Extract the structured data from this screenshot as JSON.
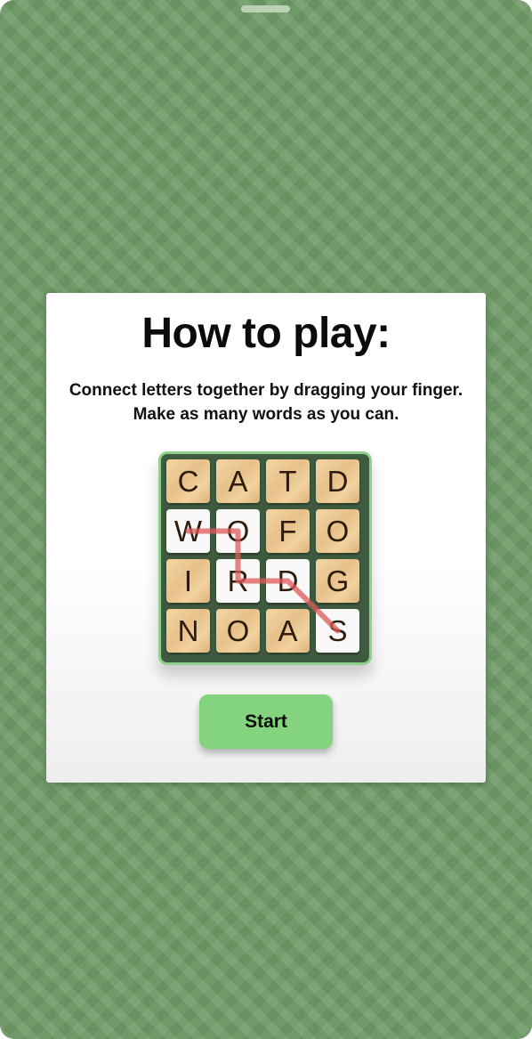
{
  "dialog": {
    "title": "How to play:",
    "instructions": "Connect letters together by dragging your finger. Make as many words as you can.",
    "start_label": "Start"
  },
  "board": {
    "tiles": [
      {
        "letter": "C",
        "selected": false
      },
      {
        "letter": "A",
        "selected": false
      },
      {
        "letter": "T",
        "selected": false
      },
      {
        "letter": "D",
        "selected": false
      },
      {
        "letter": "W",
        "selected": true
      },
      {
        "letter": "O",
        "selected": true
      },
      {
        "letter": "F",
        "selected": false
      },
      {
        "letter": "O",
        "selected": false
      },
      {
        "letter": "I",
        "selected": false
      },
      {
        "letter": "R",
        "selected": true
      },
      {
        "letter": "D",
        "selected": true
      },
      {
        "letter": "G",
        "selected": false
      },
      {
        "letter": "N",
        "selected": false
      },
      {
        "letter": "O",
        "selected": false
      },
      {
        "letter": "A",
        "selected": false
      },
      {
        "letter": "S",
        "selected": true
      }
    ],
    "path_order": [
      4,
      5,
      9,
      10,
      15
    ],
    "colors": {
      "path": "#e05a5a",
      "board_border": "#8fd18a",
      "board_bg": "#3e5a3f",
      "start_button": "#84d47f",
      "background": "#6f9a67"
    }
  }
}
